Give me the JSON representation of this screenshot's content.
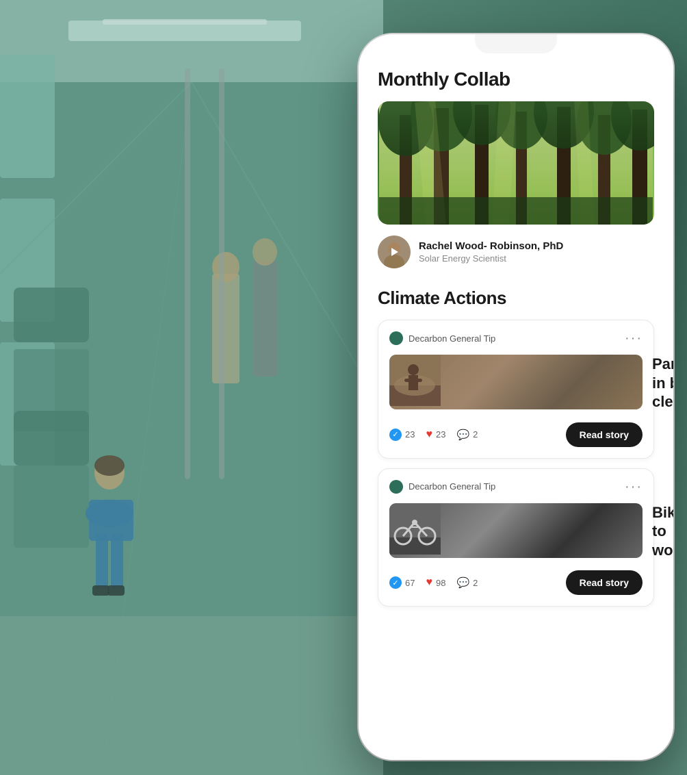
{
  "background": {
    "alt": "Bus interior with passengers"
  },
  "phone": {
    "monthly_collab": {
      "title": "Monthly Collab",
      "image_alt": "Forest trees",
      "author": {
        "name": "Rachel Wood- Robinson, PhD",
        "role": "Solar Energy Scientist"
      }
    },
    "climate_actions": {
      "title": "Climate Actions",
      "cards": [
        {
          "badge": "Decarbon General Tip",
          "title": "Participate in beach cleanup",
          "thumb_alt": "Beach cleanup",
          "stats": {
            "check": "23",
            "heart": "23",
            "comment": "2"
          },
          "button": "Read story"
        },
        {
          "badge": "Decarbon General Tip",
          "title": "Bike to work",
          "thumb_alt": "Bike to work",
          "stats": {
            "check": "67",
            "heart": "98",
            "comment": "2"
          },
          "button": "Read story"
        }
      ]
    }
  }
}
